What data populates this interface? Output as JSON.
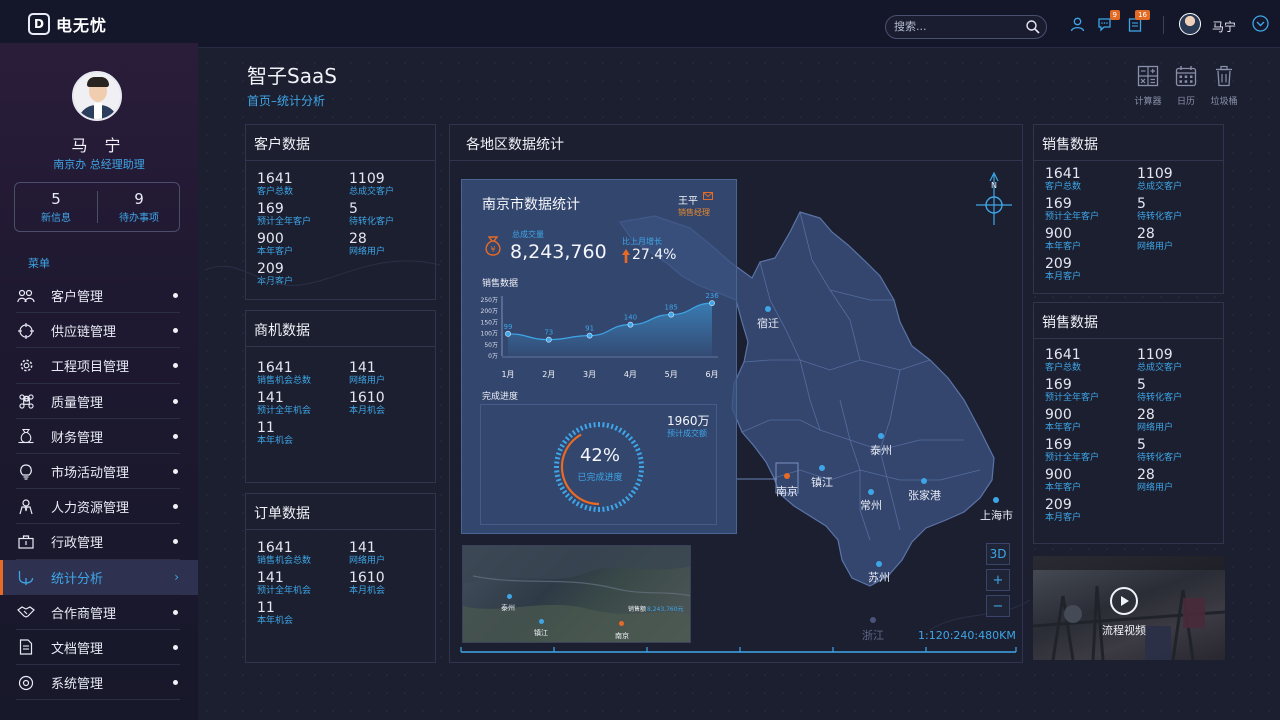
{
  "app": {
    "logo_mark": "D",
    "logo_text": "电无忧"
  },
  "topbar": {
    "search_placeholder": "搜索...",
    "messages_badge": "9",
    "tasks_badge": "16",
    "user_name": "马宁",
    "icons": [
      "user-icon",
      "chat-icon",
      "clipboard-icon",
      "search-icon",
      "chevron-down-icon"
    ]
  },
  "profile": {
    "name": "马 宁",
    "role": "南京办  总经理助理",
    "new_messages": {
      "value": "5",
      "label": "新信息"
    },
    "todos": {
      "value": "9",
      "label": "待办事项"
    }
  },
  "menu": {
    "title": "菜单",
    "items": [
      {
        "label": "客户管理",
        "icon": "users-icon"
      },
      {
        "label": "供应链管理",
        "icon": "target-icon"
      },
      {
        "label": "工程项目管理",
        "icon": "gear-icon"
      },
      {
        "label": "质量管理",
        "icon": "command-icon"
      },
      {
        "label": "财务管理",
        "icon": "money-bag-icon"
      },
      {
        "label": "市场活动管理",
        "icon": "bulb-icon"
      },
      {
        "label": "人力资源管理",
        "icon": "person-icon"
      },
      {
        "label": "行政管理",
        "icon": "briefcase-icon"
      },
      {
        "label": "统计分析",
        "icon": "chart-icon"
      },
      {
        "label": "合作商管理",
        "icon": "handshake-icon"
      },
      {
        "label": "文档管理",
        "icon": "document-icon"
      },
      {
        "label": "系统管理",
        "icon": "system-icon"
      }
    ],
    "active_index": 8
  },
  "page": {
    "title": "智子SaaS",
    "breadcrumb": "首页–统计分析"
  },
  "tools": [
    {
      "label": "计算器",
      "icon": "calculator-icon"
    },
    {
      "label": "日历",
      "icon": "calendar-icon"
    },
    {
      "label": "垃圾桶",
      "icon": "trash-icon"
    }
  ],
  "customer_panel": {
    "title": "客户数据",
    "items": [
      {
        "value": "1641",
        "label": "客户总数"
      },
      {
        "value": "1109",
        "label": "总成交客户"
      },
      {
        "value": "169",
        "label": "预计全年客户"
      },
      {
        "value": "5",
        "label": "待转化客户"
      },
      {
        "value": "900",
        "label": "本年客户"
      },
      {
        "value": "28",
        "label": "网络用户"
      },
      {
        "value": "209",
        "label": "本月客户"
      }
    ]
  },
  "opportunity_panel": {
    "title": "商机数据",
    "items": [
      {
        "value": "1641",
        "label": "销售机会总数"
      },
      {
        "value": "141",
        "label": "网络用户"
      },
      {
        "value": "141",
        "label": "预计全年机会"
      },
      {
        "value": "1610",
        "label": "本月机会"
      },
      {
        "value": "11",
        "label": "本年机会"
      }
    ]
  },
  "order_panel": {
    "title": "订单数据",
    "items": [
      {
        "value": "1641",
        "label": "销售机会总数"
      },
      {
        "value": "141",
        "label": "网络用户"
      },
      {
        "value": "141",
        "label": "预计全年机会"
      },
      {
        "value": "1610",
        "label": "本月机会"
      },
      {
        "value": "11",
        "label": "本年机会"
      }
    ]
  },
  "map_panel": {
    "title": "各地区数据统计",
    "compass_label": "N",
    "cities": [
      {
        "name": "宿迁"
      },
      {
        "name": "泰州"
      },
      {
        "name": "镇江"
      },
      {
        "name": "南京"
      },
      {
        "name": "常州"
      },
      {
        "name": "张家港"
      },
      {
        "name": "上海市"
      },
      {
        "name": "苏州"
      }
    ],
    "outside_label": "浙江",
    "scale": "1:120:240:480KM",
    "btn_3d": "3D",
    "btn_zoom_in": "+",
    "btn_zoom_out": "−",
    "minimap": {
      "labels": [
        "泰州",
        "镇江",
        "南京"
      ],
      "note_label": "销售额",
      "note_value": "8,243,760元"
    }
  },
  "city_card": {
    "title": "南京市数据统计",
    "person": "王平",
    "person_role": "销售经理",
    "total_label": "总成交量",
    "total_value": "8,243,760",
    "growth_label": "比上月增长",
    "growth_value": "27.4%",
    "sales_label": "销售数据",
    "progress_label": "完成进度",
    "target_value": "1960万",
    "target_label": "预计成交额",
    "progress_pct": "42%",
    "progress_fraction": 0.42,
    "progress_text": "已完成进度"
  },
  "chart_data": {
    "type": "area",
    "categories": [
      "1月",
      "2月",
      "3月",
      "4月",
      "5月",
      "6月"
    ],
    "values": [
      99,
      73,
      91,
      140,
      185,
      236
    ],
    "yticks": [
      "250万",
      "200万",
      "150万",
      "100万",
      "50万",
      "0万"
    ],
    "ylim": [
      0,
      250
    ],
    "title": "销售数据",
    "xlabel": "",
    "ylabel": "",
    "grid": false
  },
  "sales_panel_1": {
    "title": "销售数据",
    "items": [
      {
        "value": "1641",
        "label": "客户总数"
      },
      {
        "value": "1109",
        "label": "总成交客户"
      },
      {
        "value": "169",
        "label": "预计全年客户"
      },
      {
        "value": "5",
        "label": "待转化客户"
      },
      {
        "value": "900",
        "label": "本年客户"
      },
      {
        "value": "28",
        "label": "网络用户"
      },
      {
        "value": "209",
        "label": "本月客户"
      }
    ]
  },
  "sales_panel_2": {
    "title": "销售数据",
    "items": [
      {
        "value": "1641",
        "label": "客户总数"
      },
      {
        "value": "1109",
        "label": "总成交客户"
      },
      {
        "value": "169",
        "label": "预计全年客户"
      },
      {
        "value": "5",
        "label": "待转化客户"
      },
      {
        "value": "900",
        "label": "本年客户"
      },
      {
        "value": "28",
        "label": "网络用户"
      },
      {
        "value": "169",
        "label": "预计全年客户"
      },
      {
        "value": "5",
        "label": "待转化客户"
      },
      {
        "value": "900",
        "label": "本年客户"
      },
      {
        "value": "28",
        "label": "网络用户"
      },
      {
        "value": "209",
        "label": "本月客户"
      }
    ]
  },
  "video": {
    "label": "流程视频"
  },
  "colors": {
    "accent": "#3ea6e8",
    "orange": "#e86a24",
    "bg": "#1c1f30"
  }
}
